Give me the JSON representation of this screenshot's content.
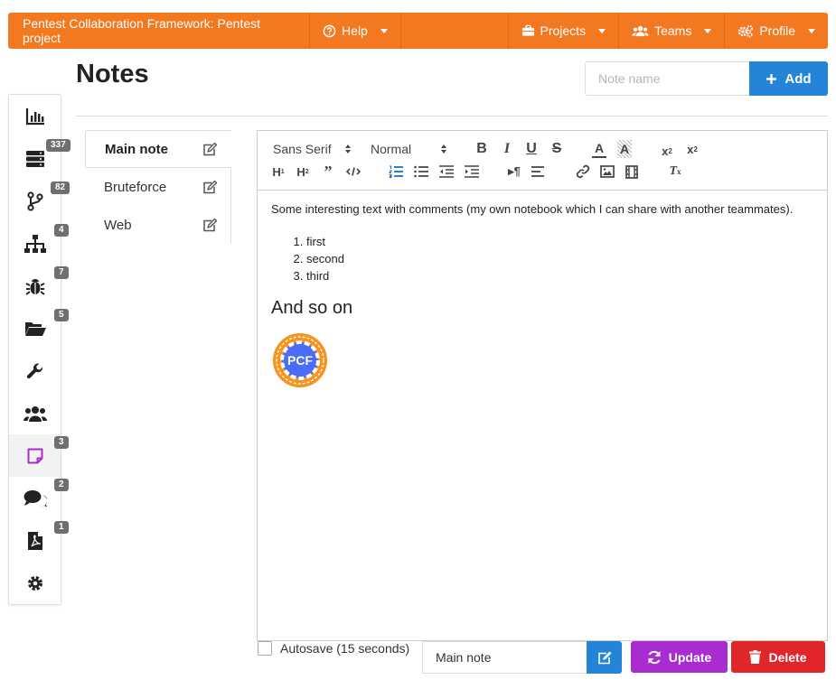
{
  "topbar": {
    "brand": "Pentest Collaboration Framework: Pentest project",
    "help": "Help",
    "projects": "Projects",
    "teams": "Teams",
    "profile": "Profile"
  },
  "page": {
    "title": "Notes"
  },
  "add_note": {
    "placeholder": "Note name",
    "button": "Add"
  },
  "sidebar": {
    "items": [
      {
        "icon": "chart-icon",
        "badge": ""
      },
      {
        "icon": "server-icon",
        "badge": "337"
      },
      {
        "icon": "branch-icon",
        "badge": "82"
      },
      {
        "icon": "network-icon",
        "badge": "4"
      },
      {
        "icon": "bug-icon",
        "badge": "7"
      },
      {
        "icon": "folder-icon",
        "badge": "5"
      },
      {
        "icon": "wrench-icon",
        "badge": ""
      },
      {
        "icon": "users-icon",
        "badge": ""
      },
      {
        "icon": "note-icon",
        "badge": "3"
      },
      {
        "icon": "comments-icon",
        "badge": "2"
      },
      {
        "icon": "pdf-icon",
        "badge": "1"
      },
      {
        "icon": "cog-icon",
        "badge": ""
      }
    ]
  },
  "notes": [
    "Main note",
    "Bruteforce",
    "Web"
  ],
  "toolbar": {
    "font": "Sans Serif",
    "size": "Normal"
  },
  "editor": {
    "paragraph": "Some interesting text with comments (my own notebook which I can share with another teammates).",
    "list": [
      "first",
      "second",
      "third"
    ],
    "heading": "And so on",
    "logo_text": "PCF"
  },
  "footer": {
    "autosave": "Autosave (15 seconds)",
    "note_name": "Main note",
    "update": "Update",
    "delete": "Delete"
  },
  "colors": {
    "orange": "#f37920",
    "blue": "#2485d8",
    "purple": "#a92cd1",
    "red": "#e0252b",
    "active_icon": "#a92cd1"
  }
}
